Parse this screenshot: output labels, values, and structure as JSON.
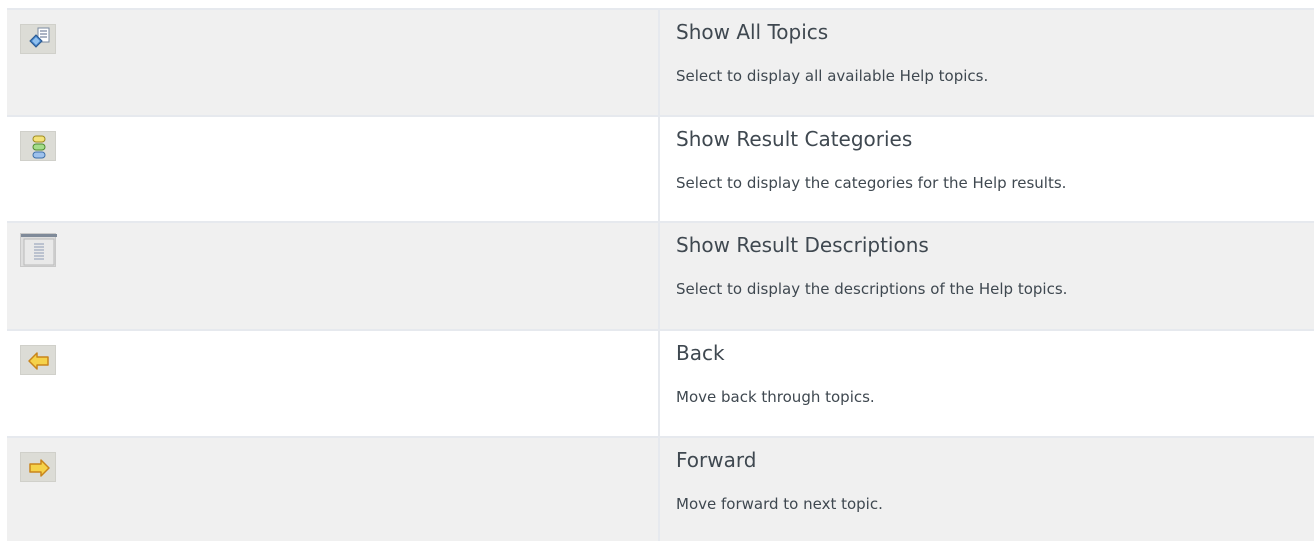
{
  "rows": [
    {
      "icon": "show-all-topics-icon",
      "title": "Show All Topics",
      "description": "Select to display all available Help topics."
    },
    {
      "icon": "show-result-categories-icon",
      "title": "Show Result Categories",
      "description": "Select to display the categories for the Help results."
    },
    {
      "icon": "show-result-descriptions-icon",
      "title": "Show Result Descriptions",
      "description": "Select to display the descriptions of the Help topics."
    },
    {
      "icon": "back-arrow-icon",
      "title": "Back",
      "description": "Move back through topics."
    },
    {
      "icon": "forward-arrow-icon",
      "title": "Forward",
      "description": "Move forward to next topic."
    }
  ],
  "colors": {
    "row_shaded": "#f0f0f0",
    "row_plain": "#ffffff",
    "border": "#e6e9ee",
    "text": "#3f4850",
    "arrow_fill": "#f5d24a",
    "arrow_stroke": "#c9851b"
  }
}
